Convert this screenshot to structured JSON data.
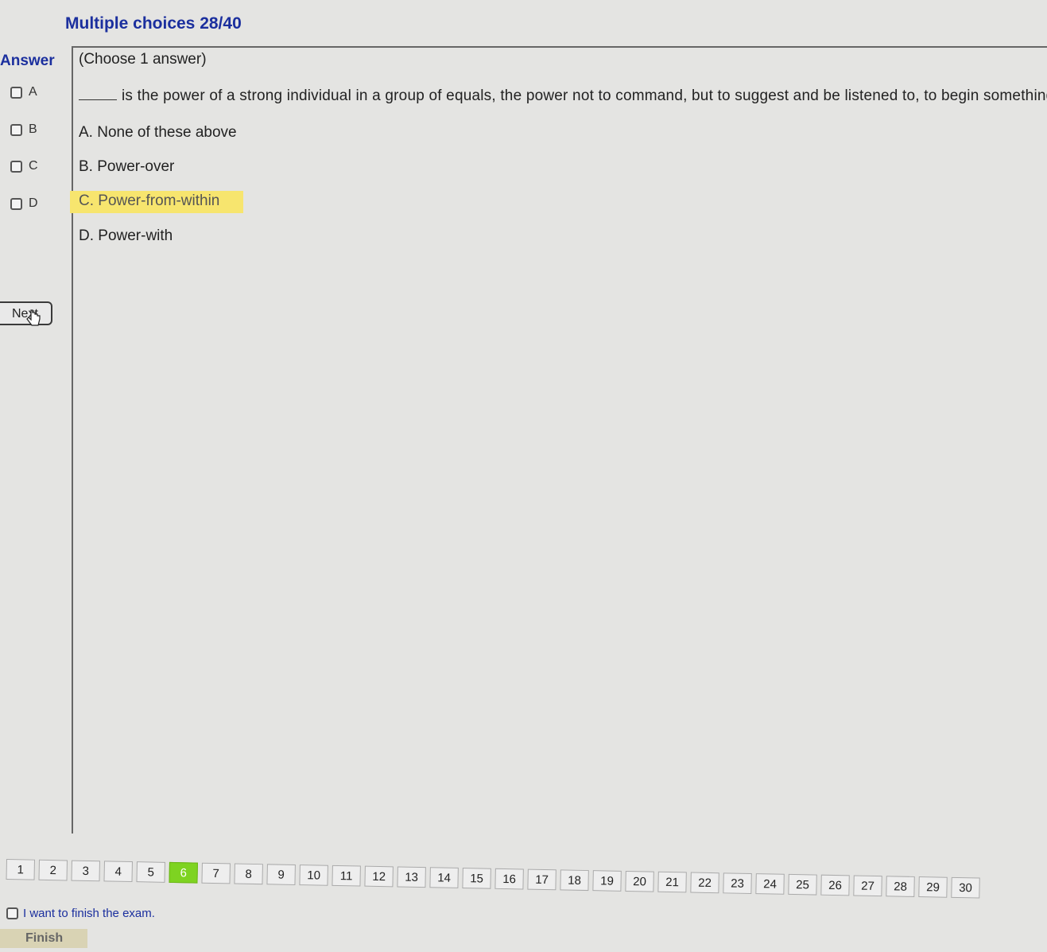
{
  "header": {
    "title": "Multiple choices 28/40"
  },
  "answer_panel": {
    "label": "Answer",
    "options": [
      {
        "letter": "A",
        "checked": false
      },
      {
        "letter": "B",
        "checked": false
      },
      {
        "letter": "C",
        "checked": false
      },
      {
        "letter": "D",
        "checked": false
      }
    ],
    "next_label": "Next"
  },
  "question": {
    "instruction": "(Choose 1 answer)",
    "text": "is the power of a strong individual in a group of equals, the power not to command, but to suggest and be listened to, to begin something",
    "choices": [
      {
        "text": "A. None of these above",
        "highlighted": false
      },
      {
        "text": "B. Power-over",
        "highlighted": false
      },
      {
        "text": "C. Power-from-within",
        "highlighted": true
      },
      {
        "text": "D. Power-with",
        "highlighted": false
      }
    ],
    "highlight_color": "#f7e56e"
  },
  "pager": {
    "pages": [
      "1",
      "2",
      "3",
      "4",
      "5",
      "6",
      "7",
      "8",
      "9",
      "10",
      "11",
      "12",
      "13",
      "14",
      "15",
      "16",
      "17",
      "18",
      "19",
      "20",
      "21",
      "22",
      "23",
      "24",
      "25",
      "26",
      "27",
      "28",
      "29",
      "30"
    ],
    "active_page": "6",
    "active_color": "#7ed321"
  },
  "footer": {
    "finish_checkbox_label": "I want to finish the exam.",
    "finish_button_label": "Finish"
  },
  "colors": {
    "accent": "#1b2f9e",
    "background": "#e4e4e2"
  }
}
